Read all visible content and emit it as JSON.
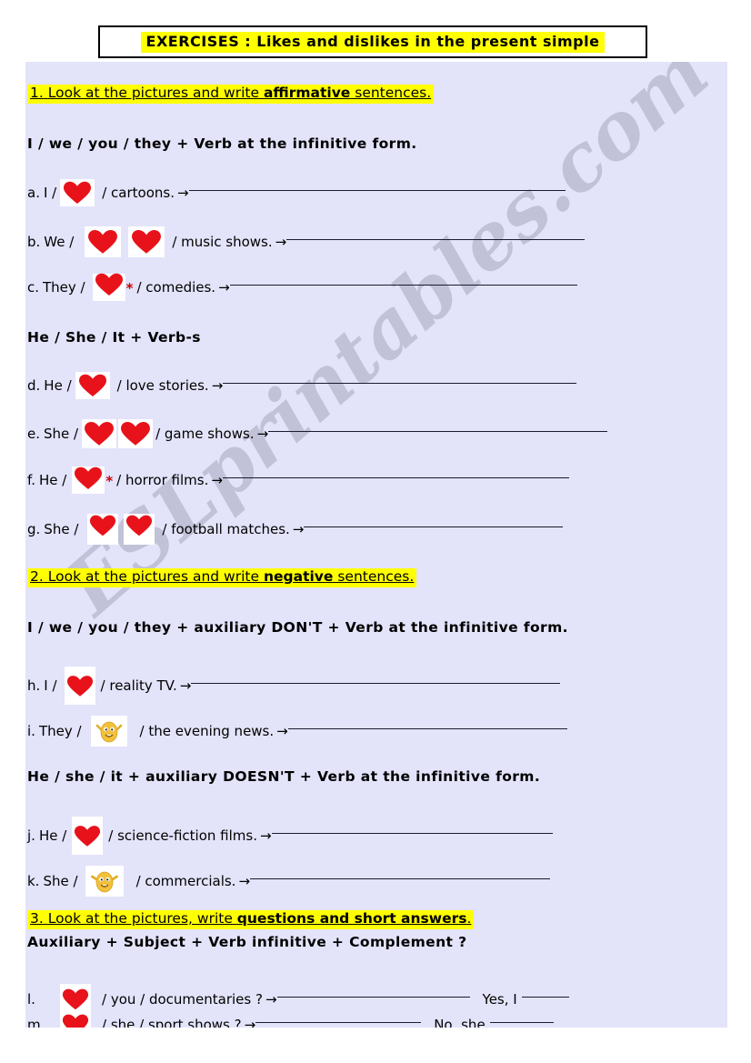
{
  "title": {
    "text": "EXERCISES  :  Likes  and  dislikes  in  the  present  simple"
  },
  "watermark": {
    "text": "ESLprintables.com"
  },
  "colors": {
    "sheet_background": "#e3e3fa",
    "highlight": "#ffff00",
    "heart_red": "#e8121a",
    "face_yellow": "#f2c13c",
    "rule_line": "#1b1b2e",
    "asterisk_red": "#cc0000"
  },
  "exercises": [
    {
      "number": "1.",
      "instruction_plain": "Look at the pictures and write ",
      "instruction_bold": "affirmative",
      "instruction_tail": " sentences."
    },
    {
      "number": "2.",
      "instruction_plain": "Look at the pictures and write ",
      "instruction_bold": "negative",
      "instruction_tail": " sentences."
    },
    {
      "number": "3.",
      "instruction_plain": "Look at the pictures, write ",
      "instruction_bold": "questions and short answers",
      "instruction_tail": "."
    }
  ],
  "rules": {
    "rule1": "I / we / you / they + Verb at the infinitive form.",
    "rule2": "He / She / It + Verb-s",
    "rule3": "I / we / you / they + auxiliary DON'T + Verb at the infinitive form.",
    "rule4": "He / she / it  + auxiliary DOESN'T + Verb at the infinitive form.",
    "rule5": "Auxiliary + Subject + Verb infinitive + Complement ?"
  },
  "items": [
    {
      "id": "a",
      "label": "a.",
      "subject": "I  /",
      "icons": [
        "heart"
      ],
      "star": false,
      "object": "/ cartoons.",
      "arrow": "→"
    },
    {
      "id": "b",
      "label": "b.",
      "subject": "We /",
      "icons": [
        "heart",
        "heart"
      ],
      "star": false,
      "object": "/ music shows.",
      "arrow": "→"
    },
    {
      "id": "c",
      "label": "c.",
      "subject": "They /",
      "icons": [
        "heart"
      ],
      "star": true,
      "object": "/ comedies.",
      "arrow": "→"
    },
    {
      "id": "d",
      "label": "d.",
      "subject": "He /",
      "icons": [
        "heart"
      ],
      "star": false,
      "object": "/ love stories.",
      "arrow": "→"
    },
    {
      "id": "e",
      "label": "e.",
      "subject": "She /",
      "icons": [
        "heart",
        "heart"
      ],
      "star": false,
      "object": "/ game shows.",
      "arrow": "→"
    },
    {
      "id": "f",
      "label": "f.",
      "subject": "He /",
      "icons": [
        "heart"
      ],
      "star": true,
      "object": "/ horror films.",
      "arrow": "→"
    },
    {
      "id": "g",
      "label": "g.",
      "subject": "She /",
      "icons": [
        "heart",
        "heart"
      ],
      "star": false,
      "object": "/ football matches.",
      "arrow": "→"
    },
    {
      "id": "h",
      "label": "h.",
      "subject": "I /",
      "icons": [
        "heart"
      ],
      "star": false,
      "object": "/ reality TV.",
      "arrow": "→"
    },
    {
      "id": "i",
      "label": "i.",
      "subject": "They   /",
      "icons": [
        "face"
      ],
      "star": false,
      "object": "/ the evening news.",
      "arrow": "→"
    },
    {
      "id": "j",
      "label": "j.",
      "subject": "He /",
      "icons": [
        "heart"
      ],
      "star": false,
      "object": "/ science-fiction films.",
      "arrow": "→"
    },
    {
      "id": "k",
      "label": "k.",
      "subject": "She  /",
      "icons": [
        "face"
      ],
      "star": false,
      "object": "/ commercials.",
      "arrow": "→"
    },
    {
      "id": "l",
      "label": "l.",
      "subject": "",
      "icons": [
        "heart"
      ],
      "star": false,
      "object": "/ you / documentaries ?",
      "arrow": "→",
      "answer_prefix": "Yes, I"
    },
    {
      "id": "m",
      "label": "m.",
      "subject": "",
      "icons": [
        "heart"
      ],
      "star": false,
      "object": "/ she / sport shows ?",
      "arrow": "→",
      "answer_prefix": "No, she"
    }
  ],
  "icon_names": {
    "heart": "heart-icon",
    "face": "smiley-face-icon"
  }
}
